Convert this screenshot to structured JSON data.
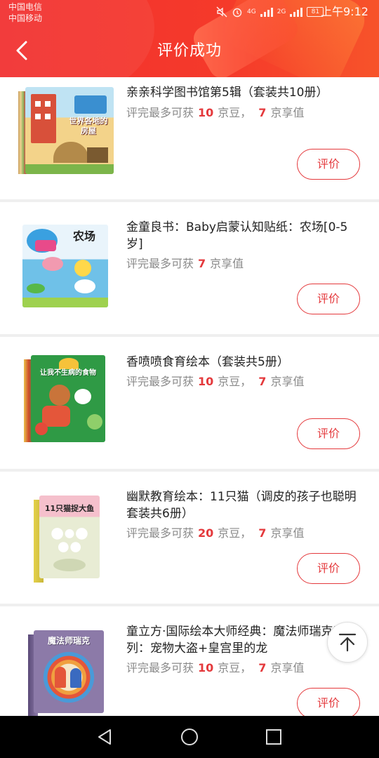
{
  "status_bar": {
    "carrier_1": "中国电信",
    "carrier_2": "中国移动",
    "network_1": "4G",
    "network_2": "2G",
    "battery": "81",
    "time": "上午9:12"
  },
  "header": {
    "title": "评价成功",
    "back_icon": "back-arrow-icon"
  },
  "reward_labels": {
    "prefix": "评完最多可获",
    "jingdou": "京豆，",
    "jingxiang": "京享值"
  },
  "products": [
    {
      "name": "亲亲科学图书馆第5辑（套装共10册）",
      "jingdou": "10",
      "jingxiang": "7",
      "button": "评价",
      "cover_text": "世界各地的房屋",
      "cover_color": "#f3d38a"
    },
    {
      "name": "金童良书：Baby启蒙认知贴纸：农场[0-5岁]",
      "jingxiang": "7",
      "button": "评价",
      "cover_text": "农场",
      "cover_color": "#7ecbee"
    },
    {
      "name": "香喷喷食育绘本（套装共5册）",
      "jingdou": "10",
      "jingxiang": "7",
      "button": "评价",
      "cover_text": "让我不生病的食物",
      "cover_color": "#2f9a45"
    },
    {
      "name": "幽默教育绘本：11只猫（调皮的孩子也聪明套装共6册）",
      "jingdou": "20",
      "jingxiang": "7",
      "button": "评价",
      "cover_text": "11只猫捉大鱼",
      "cover_color": "#f3b7c3"
    },
    {
      "name": "童立方·国际绘本大师经典：魔法师瑞克系列：宠物大盗+皇宫里的龙",
      "jingdou": "10",
      "jingxiang": "7",
      "button": "评价",
      "cover_text": "魔法师瑞克",
      "cover_color": "#8c7aa8"
    }
  ],
  "scroll_top_icon": "arrow-up-to-top-icon",
  "nav_bar": {
    "back": "triangle-back-icon",
    "home": "circle-home-icon",
    "recents": "square-recents-icon"
  },
  "colors": {
    "accent": "#e4393c",
    "header": "#f23030"
  }
}
